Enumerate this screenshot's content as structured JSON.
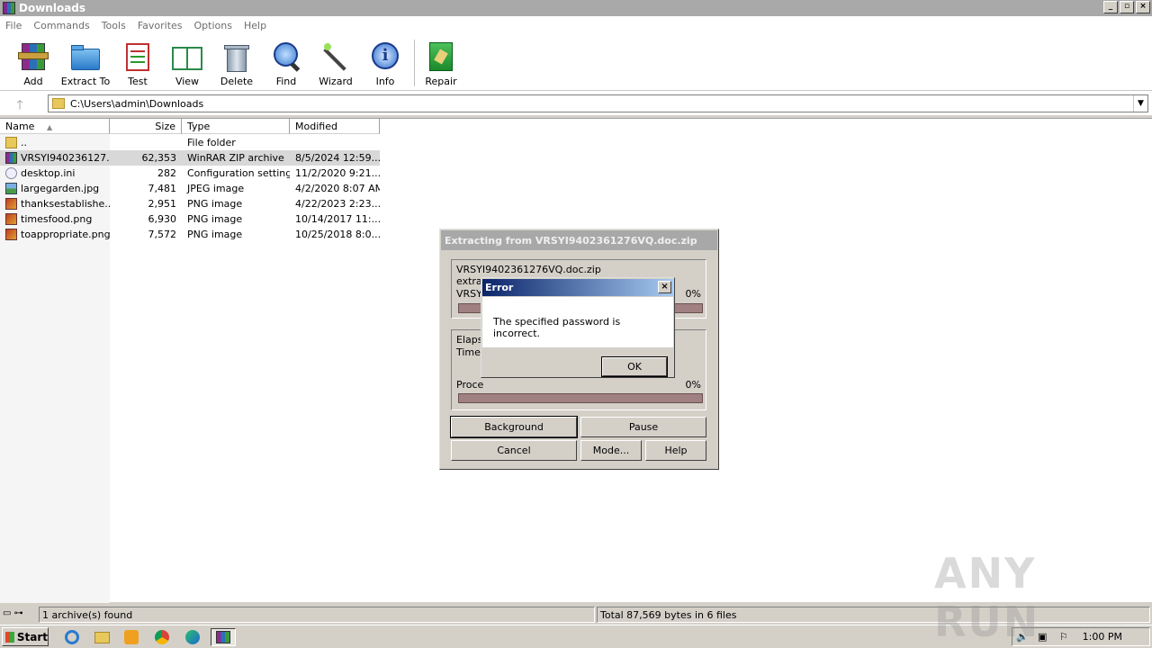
{
  "window": {
    "title": "Downloads",
    "buttons": [
      "_",
      "▫",
      "×"
    ]
  },
  "menu": [
    "File",
    "Commands",
    "Tools",
    "Favorites",
    "Options",
    "Help"
  ],
  "toolbar": [
    {
      "label": "Add",
      "icon": "add-archive-icon"
    },
    {
      "label": "Extract To",
      "icon": "extract-folder-icon"
    },
    {
      "label": "Test",
      "icon": "test-clipboard-icon"
    },
    {
      "label": "View",
      "icon": "view-book-icon"
    },
    {
      "label": "Delete",
      "icon": "trash-icon"
    },
    {
      "label": "Find",
      "icon": "magnifier-icon"
    },
    {
      "label": "Wizard",
      "icon": "wand-icon"
    },
    {
      "label": "Info",
      "icon": "info-icon"
    },
    {
      "label": "Repair",
      "icon": "repair-icon"
    }
  ],
  "address": {
    "path": "C:\\Users\\admin\\Downloads"
  },
  "columns": {
    "name": "Name",
    "size": "Size",
    "type": "Type",
    "modified": "Modified"
  },
  "files": [
    {
      "name": "..",
      "size": "",
      "type": "File folder",
      "modified": "",
      "icon": "folder-up"
    },
    {
      "name": "VRSYI940236127...",
      "size": "62,353",
      "type": "WinRAR ZIP archive",
      "modified": "8/5/2024 12:59...",
      "icon": "zip"
    },
    {
      "name": "desktop.ini",
      "size": "282",
      "type": "Configuration settings",
      "modified": "11/2/2020 9:21...",
      "icon": "ini"
    },
    {
      "name": "largegarden.jpg",
      "size": "7,481",
      "type": "JPEG image",
      "modified": "4/2/2020 8:07 AM",
      "icon": "jpg"
    },
    {
      "name": "thanksestablishe...",
      "size": "2,951",
      "type": "PNG image",
      "modified": "4/22/2023 2:23...",
      "icon": "png"
    },
    {
      "name": "timesfood.png",
      "size": "6,930",
      "type": "PNG image",
      "modified": "10/14/2017 11:...",
      "icon": "png"
    },
    {
      "name": "toappropriate.png",
      "size": "7,572",
      "type": "PNG image",
      "modified": "10/25/2018 8:0...",
      "icon": "png"
    }
  ],
  "status": {
    "left": "1 archive(s) found",
    "right": "Total 87,569 bytes in 6 files"
  },
  "extract_dialog": {
    "title": "Extracting from VRSYI9402361276VQ.doc.zip",
    "archive": "VRSYI9402361276VQ.doc.zip",
    "line2": "extra",
    "line3": "VRSY",
    "file_percent": "0%",
    "file_progress": 0.0,
    "elapsed": "Elapse",
    "time_left": "Time l",
    "processed": "Proce",
    "total_percent": "0%",
    "total_progress": 0.0,
    "buttons": {
      "background": "Background",
      "pause": "Pause",
      "cancel": "Cancel",
      "mode": "Mode...",
      "help": "Help"
    }
  },
  "error_dialog": {
    "title": "Error",
    "message": "The specified password is incorrect.",
    "ok": "OK",
    "close": "×"
  },
  "taskbar": {
    "start": "Start",
    "clock": "1:00 PM"
  },
  "watermark": "ANY RUN"
}
